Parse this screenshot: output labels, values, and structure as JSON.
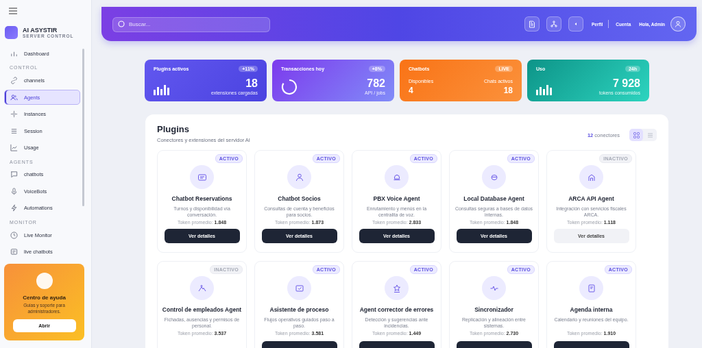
{
  "sidebar": {
    "brand": {
      "name": "AI ASYSTIR",
      "subtitle": "SERVER CONTROL"
    },
    "sections": [
      {
        "items": [
          {
            "label": "Dashboard",
            "selected": false
          }
        ]
      },
      {
        "heading": "CONTROL",
        "items": [
          {
            "label": "channels",
            "selected": false
          },
          {
            "label": "Agents",
            "selected": true
          },
          {
            "label": "Instances",
            "selected": false
          },
          {
            "label": "Session",
            "selected": false
          },
          {
            "label": "Usage",
            "selected": false
          }
        ]
      },
      {
        "heading": "AGENTS",
        "items": [
          {
            "label": "chatbots",
            "selected": false
          },
          {
            "label": "VoiceBots",
            "selected": false
          },
          {
            "label": "Automations",
            "selected": false
          }
        ]
      },
      {
        "heading": "MONITOR",
        "items": [
          {
            "label": "Live Monitor",
            "selected": false
          },
          {
            "label": "live chatbots",
            "selected": false
          }
        ]
      }
    ],
    "help": {
      "title": "Centro de ayuda",
      "text": "Guías y soporte para administradores.",
      "button": "Abrir"
    }
  },
  "header": {
    "search": {
      "placeholder": "Buscar..."
    },
    "links": [
      "Perfil",
      "Cuenta"
    ],
    "greeting": "Hola, Admin"
  },
  "stats": [
    {
      "kind": "bars",
      "title": "Plugins activos",
      "badge": "+11%",
      "value": "18",
      "caption": "extensiones cargadas"
    },
    {
      "kind": "ring",
      "title": "Transacciones hoy",
      "badge": "+8%",
      "value": "782",
      "caption": "API / jobs"
    },
    {
      "kind": "split",
      "title": "Chatbots",
      "badge": "LIVE",
      "columns": [
        {
          "label": "Disponibles",
          "value": "4"
        },
        {
          "label": "Chats activos",
          "value": "18"
        }
      ]
    },
    {
      "kind": "bars",
      "title": "Uso",
      "badge": "24h",
      "value": "7 928",
      "caption": "tokens consumidos"
    }
  ],
  "plugins": {
    "title": "Plugins",
    "subtitle": "Conectores y extensiones del servidor AI",
    "count": "12",
    "count_label": "conectores",
    "views": [
      {
        "selected": true
      },
      {
        "selected": false
      }
    ],
    "cards": [
      {
        "status": "ACTIVO",
        "active": true,
        "name": "Chatbot Reservations",
        "description": "Turnos y disponibilidad vía conversación.",
        "tokens": "Token promedio: **1.848**",
        "button": "Ver detalles"
      },
      {
        "status": "ACTIVO",
        "active": true,
        "name": "Chatbot Socios",
        "description": "Consultas de cuenta y beneficios para socios.",
        "tokens": "Token promedio: **1.873**",
        "button": "Ver detalles"
      },
      {
        "status": "ACTIVO",
        "active": true,
        "name": "PBX Voice Agent",
        "description": "Enrutamiento y menús en la centralita de voz.",
        "tokens": "Token promedio: **2.833**",
        "button": "Ver detalles"
      },
      {
        "status": "ACTIVO",
        "active": true,
        "name": "Local Database Agent",
        "description": "Consultas seguras a bases de datos internas.",
        "tokens": "Token promedio: **1.848**",
        "button": "Ver detalles"
      },
      {
        "status": "INACTIVO",
        "active": false,
        "name": "ARCA API Agent",
        "description": "Integración con servicios fiscales ARCA.",
        "tokens": "Token promedio: **1.118**",
        "button": "Ver detalles"
      },
      {
        "status": "INACTIVO",
        "active": false,
        "name": "Control de empleados Agent",
        "description": "Fichadas, ausencias y permisos de personal.",
        "tokens": "Token promedio: **3.537**"
      },
      {
        "status": "ACTIVO",
        "active": true,
        "name": "Asistente de proceso",
        "description": "Flujos operativos guiados paso a paso.",
        "tokens": "Token promedio: **3.581**",
        "button_cut": true
      },
      {
        "status": "ACTIVO",
        "active": true,
        "name": "Agent corrector de errores",
        "description": "Detección y sugerencias ante incidencias.",
        "tokens": "Token promedio: **1.449**",
        "button_cut": true
      },
      {
        "status": "ACTIVO",
        "active": true,
        "name": "Sincronizador",
        "description": "Replicación y alineación entre sistemas.",
        "tokens": "Token promedio: **2.730**",
        "button_cut": true
      },
      {
        "status": "ACTIVO",
        "active": true,
        "name": "Agenda interna",
        "description": "Calendario y reuniones del equipo.",
        "tokens": "Token promedio: **1.910**",
        "button_cut": true
      }
    ]
  }
}
